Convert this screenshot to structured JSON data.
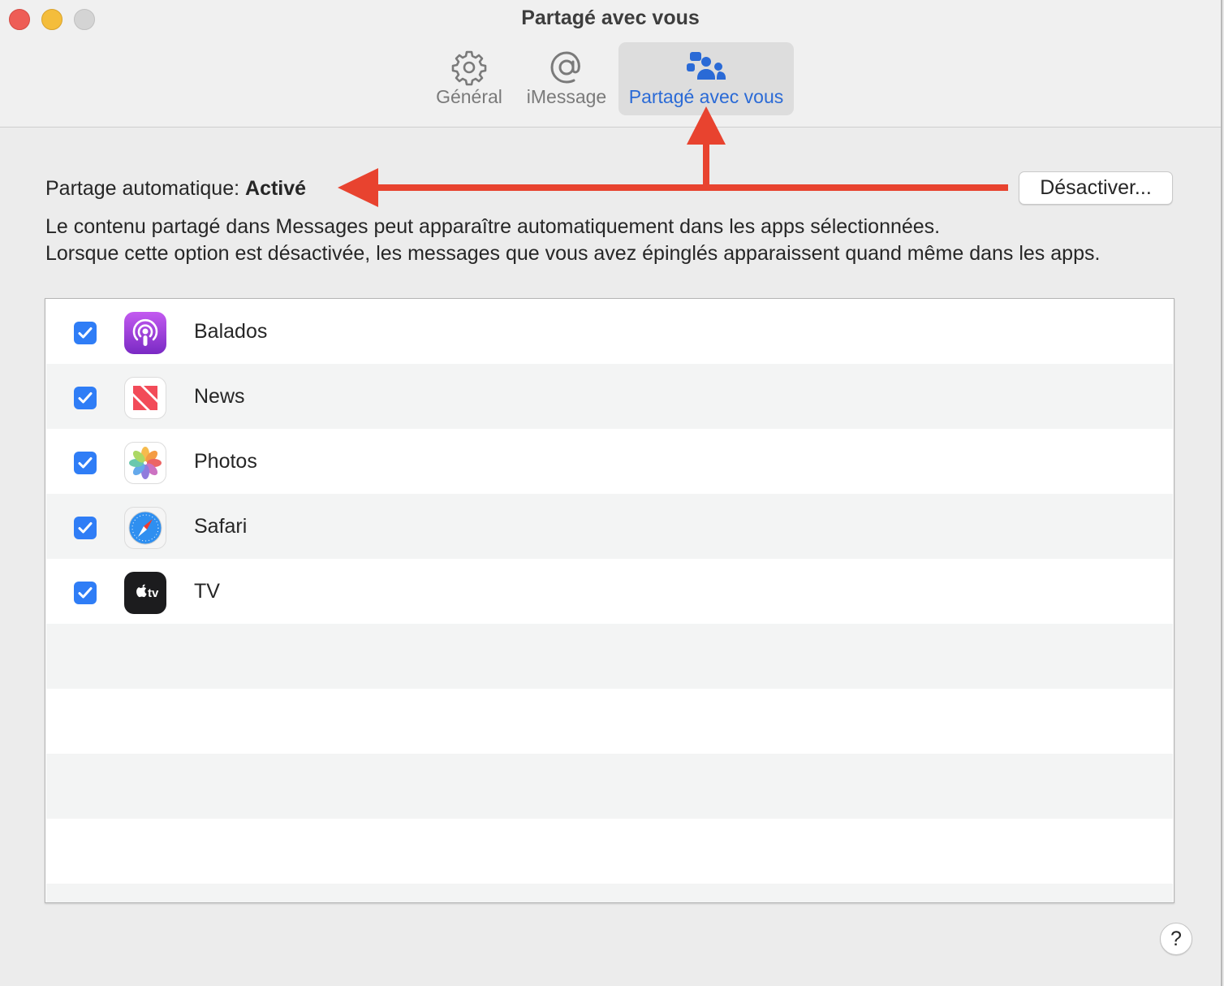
{
  "window": {
    "title": "Partagé avec vous"
  },
  "tabs": [
    {
      "label": "Général",
      "icon": "gear-icon",
      "selected": false
    },
    {
      "label": "iMessage",
      "icon": "at-sign-icon",
      "selected": false
    },
    {
      "label": "Partagé avec vous",
      "icon": "shared-with-you-icon",
      "selected": true
    }
  ],
  "status": {
    "label": "Partage automatique:",
    "value": "Activé"
  },
  "disable_button": "Désactiver...",
  "description": {
    "line1": "Le contenu partagé dans Messages peut apparaître automatiquement dans les apps sélectionnées.",
    "line2": "Lorsque cette option est désactivée, les messages que vous avez épinglés apparaissent quand même dans les apps."
  },
  "apps": [
    {
      "name": "Balados",
      "checked": true,
      "icon": "podcasts-icon"
    },
    {
      "name": "News",
      "checked": true,
      "icon": "news-icon"
    },
    {
      "name": "Photos",
      "checked": true,
      "icon": "photos-icon"
    },
    {
      "name": "Safari",
      "checked": true,
      "icon": "safari-icon"
    },
    {
      "name": "TV",
      "checked": true,
      "icon": "apple-tv-icon"
    }
  ],
  "tv_icon_text": "tv",
  "help_button": "?",
  "colors": {
    "accent": "#2a6ad6",
    "checkbox": "#2f7df6",
    "annotation_arrow": "#e8432f"
  }
}
